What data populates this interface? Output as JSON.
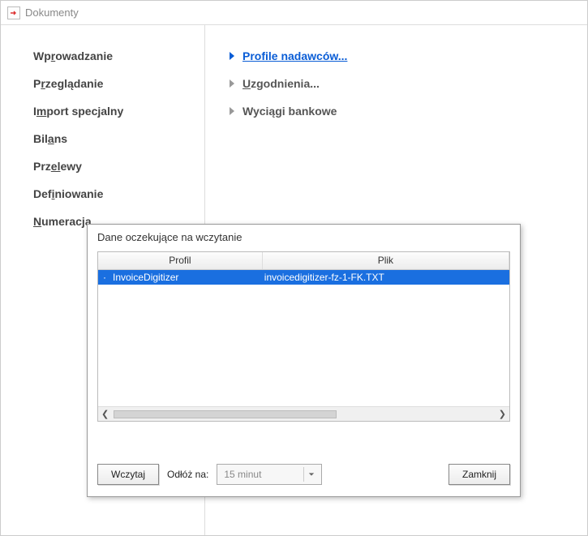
{
  "window": {
    "title": "Dokumenty"
  },
  "left_menu": {
    "items": [
      {
        "pre": "Wp",
        "u": "r",
        "post": "owadzanie"
      },
      {
        "pre": "P",
        "u": "r",
        "post": "zeglądanie"
      },
      {
        "pre": "I",
        "u": "m",
        "post": "port specjalny"
      },
      {
        "pre": "Bil",
        "u": "a",
        "post": "ns"
      },
      {
        "pre": "Prz",
        "u": "el",
        "post": "ewy"
      },
      {
        "pre": "Def",
        "u": "i",
        "post": "niowanie"
      },
      {
        "pre": "",
        "u": "N",
        "post": "umeracja"
      }
    ]
  },
  "right_links": {
    "items": [
      {
        "pre": "",
        "u": "P",
        "post": "rofile nadawców...",
        "active": true
      },
      {
        "pre": "",
        "u": "U",
        "post": "zgodnienia...",
        "active": false
      },
      {
        "pre": "Wyciągi bankowe",
        "u": "",
        "post": "",
        "active": false
      }
    ]
  },
  "dialog": {
    "title": "Dane oczekujące na wczytanie",
    "columns": {
      "profil": "Profil",
      "plik": "Plik"
    },
    "rows": [
      {
        "profil": "InvoiceDigitizer",
        "plik": "invoicedigitizer-fz-1-FK.TXT"
      }
    ],
    "buttons": {
      "load": "Wczytaj",
      "postpone_label": "Odłóż na:",
      "postpone_value": "15 minut",
      "close": "Zamknij"
    }
  }
}
